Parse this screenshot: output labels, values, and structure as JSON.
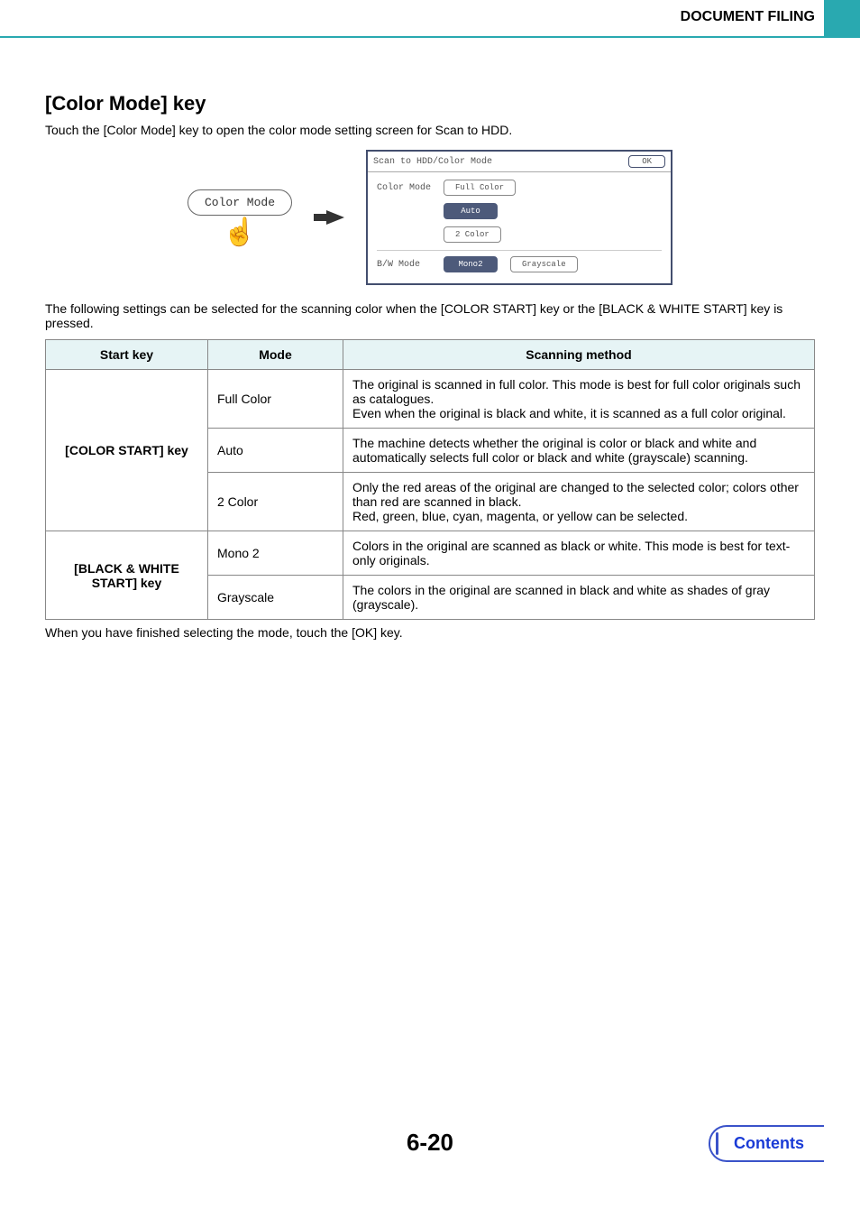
{
  "header": {
    "title": "DOCUMENT FILING"
  },
  "heading": "[Color Mode] key",
  "intro": "Touch the [Color Mode] key to open the color mode setting screen for Scan to HDD.",
  "key_button": "Color Mode",
  "panel": {
    "title": "Scan to HDD/Color Mode",
    "ok": "OK",
    "color_label": "Color Mode",
    "opts": {
      "full": "Full Color",
      "auto": "Auto",
      "two": "2 Color"
    },
    "bw_label": "B/W Mode",
    "bw_opts": {
      "mono2": "Mono2",
      "gray": "Grayscale"
    }
  },
  "after_illus": "The following settings can be selected for the scanning color when the [COLOR START] key or the [BLACK & WHITE START] key is pressed.",
  "table": {
    "head": {
      "c1": "Start key",
      "c2": "Mode",
      "c3": "Scanning method"
    },
    "group1": "[COLOR START] key",
    "group2": "[BLACK & WHITE START] key",
    "rows": [
      {
        "mode": "Full Color",
        "desc": "The original is scanned in full color. This mode is best for full color originals such as catalogues.\nEven when the original is black and white, it is scanned as a full color original."
      },
      {
        "mode": "Auto",
        "desc": "The machine detects whether the original is color or black and white and automatically selects full color or black and white (grayscale) scanning."
      },
      {
        "mode": "2 Color",
        "desc": "Only the red areas of the original are changed to the selected color; colors other than red are scanned in black.\nRed, green, blue, cyan, magenta, or yellow can be selected."
      },
      {
        "mode": "Mono 2",
        "desc": "Colors in the original are scanned as black or white. This mode is best for text-only originals."
      },
      {
        "mode": "Grayscale",
        "desc": "The colors in the original are scanned in black and white as shades of gray (grayscale)."
      }
    ]
  },
  "closing": "When you have finished selecting the mode, touch the [OK] key.",
  "page_num": "6-20",
  "contents": "Contents"
}
